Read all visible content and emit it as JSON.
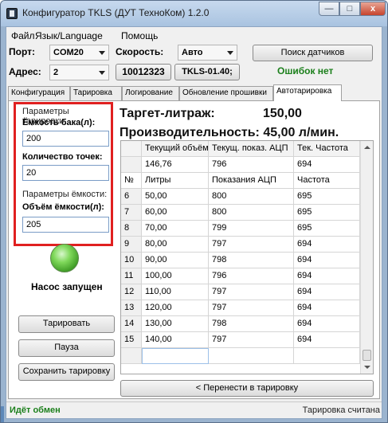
{
  "window": {
    "title": "Конфигуратор TKLS (ДУТ ТехноКом) 1.2.0",
    "minimize_glyph": "—",
    "maximize_glyph": "□",
    "close_glyph": "x"
  },
  "menu": {
    "file": "Файл",
    "language": "Язык/Language",
    "help": "Помощь"
  },
  "toolbar": {
    "port_label": "Порт:",
    "port_value": "COM20",
    "speed_label": "Скорость:",
    "speed_value": "Авто",
    "search_button": "Поиск датчиков",
    "address_label": "Адрес:",
    "address_value": "2",
    "serial_value": "10012323",
    "firmware_value": "TKLS-01.40;",
    "errors_status": "Ошибок нет"
  },
  "tabs": [
    {
      "label": "Конфигурация"
    },
    {
      "label": "Тарировка"
    },
    {
      "label": "Логирование"
    },
    {
      "label": "Обновление прошивки"
    },
    {
      "label": "Автотарировка"
    }
  ],
  "params": {
    "title": "Параметры тарировки",
    "tank_label": "Ёмкость бака(л):",
    "tank_value": "200",
    "points_label": "Количество точек:",
    "points_value": "20",
    "capacity_title": "Параметры ёмкости:",
    "volume_label": "Объём ёмкости(л):",
    "volume_value": "205"
  },
  "pump_status": "Насос запущен",
  "buttons": {
    "calibrate": "Тарировать",
    "pause": "Пауза",
    "save": "Сохранить тарировку",
    "transfer": "< Перенести в тарировку"
  },
  "target": {
    "label": "Таргет-литраж:",
    "value": "150,00"
  },
  "productivity": "Производительность: 45,00 л/мин.",
  "grid": {
    "top_headers": [
      "Текущий объём",
      "Текущ. показ. АЦП",
      "Тек. Частота"
    ],
    "current_values": [
      "146,76",
      "796",
      "694"
    ],
    "headers": [
      "№",
      "Литры",
      "Показания АЦП",
      "Частота"
    ],
    "rows": [
      [
        "6",
        "50,00",
        "800",
        "695"
      ],
      [
        "7",
        "60,00",
        "800",
        "695"
      ],
      [
        "8",
        "70,00",
        "799",
        "695"
      ],
      [
        "9",
        "80,00",
        "797",
        "694"
      ],
      [
        "10",
        "90,00",
        "798",
        "694"
      ],
      [
        "11",
        "100,00",
        "796",
        "694"
      ],
      [
        "12",
        "110,00",
        "797",
        "694"
      ],
      [
        "13",
        "120,00",
        "797",
        "694"
      ],
      [
        "14",
        "130,00",
        "798",
        "694"
      ],
      [
        "15",
        "140,00",
        "797",
        "694"
      ]
    ]
  },
  "status": {
    "left": "Идёт обмен",
    "right": "Тарировка считана"
  }
}
